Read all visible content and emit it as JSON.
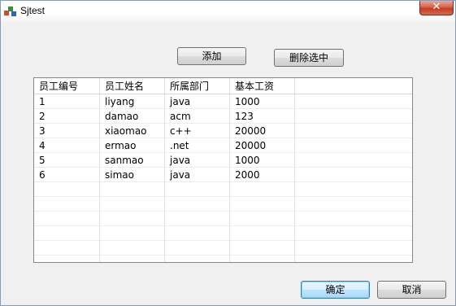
{
  "window": {
    "title": "Sjtest",
    "close_label": "✕"
  },
  "toolbar": {
    "add_label": "添加",
    "delete_selected_label": "删除选中"
  },
  "table": {
    "columns": [
      "员工编号",
      "员工姓名",
      "所属部门",
      "基本工资"
    ],
    "rows": [
      [
        "1",
        "liyang",
        "java",
        "1000"
      ],
      [
        "2",
        "damao",
        "acm",
        "123"
      ],
      [
        "3",
        "xiaomao",
        "c++",
        "20000"
      ],
      [
        "4",
        "ermao",
        ".net",
        "20000"
      ],
      [
        "5",
        "sanmao",
        "java",
        "1000"
      ],
      [
        "6",
        "simao",
        "java",
        "2000"
      ]
    ],
    "empty_rows": 6
  },
  "footer": {
    "ok_label": "确定",
    "cancel_label": "取消"
  }
}
